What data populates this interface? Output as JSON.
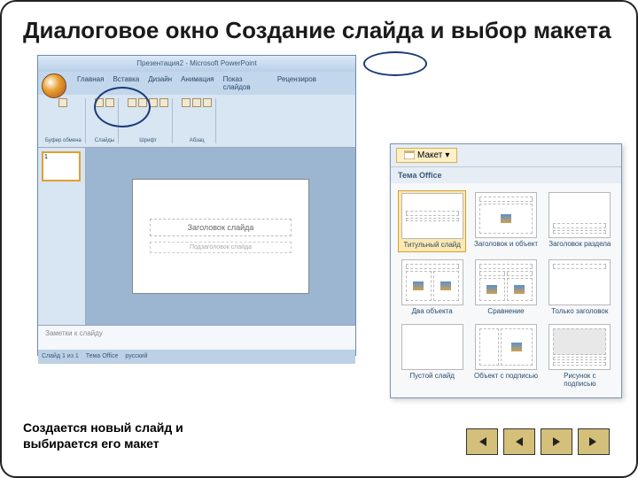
{
  "title": "Диалоговое окно Создание слайда и выбор макета",
  "caption": "Создается новый слайд и выбирается его макет",
  "ppt": {
    "windowTitle": "Презентация2 - Microsoft PowerPoint",
    "tabs": [
      "Главная",
      "Вставка",
      "Дизайн",
      "Анимация",
      "Показ слайдов",
      "Рецензиров"
    ],
    "groups": {
      "clipboard": "Буфер обмена",
      "slides": "Слайды",
      "font": "Шрифт",
      "para": "Абзац"
    },
    "thumbNum": "1",
    "slideTitle": "Заголовок слайда",
    "slideSub": "Подзаголовок слайда",
    "notes": "Заметки к слайду",
    "status": {
      "slide": "Слайд 1 из 1",
      "theme": "Тема Office",
      "lang": "русский"
    }
  },
  "layoutPanel": {
    "button": "Макет",
    "theme": "Тема Office",
    "items": [
      {
        "label": "Титульный слайд",
        "selected": true
      },
      {
        "label": "Заголовок и объект",
        "selected": false
      },
      {
        "label": "Заголовок раздела",
        "selected": false
      },
      {
        "label": "Два объекта",
        "selected": false
      },
      {
        "label": "Сравнение",
        "selected": false
      },
      {
        "label": "Только заголовок",
        "selected": false
      },
      {
        "label": "Пустой слайд",
        "selected": false
      },
      {
        "label": "Объект с подписью",
        "selected": false
      },
      {
        "label": "Рисунок с подписью",
        "selected": false
      }
    ]
  }
}
